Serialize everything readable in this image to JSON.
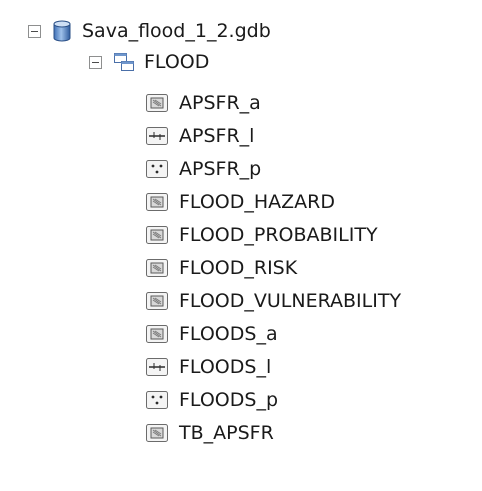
{
  "tree": {
    "database": {
      "label": "Sava_flood_1_2.gdb",
      "icon": "database-icon",
      "expanded": true
    },
    "dataset": {
      "label": "FLOOD",
      "icon": "feature-dataset-icon",
      "expanded": true
    },
    "feature_classes": [
      {
        "label": "APSFR_a",
        "icon": "polygon-feature-class-icon"
      },
      {
        "label": "APSFR_l",
        "icon": "line-feature-class-icon"
      },
      {
        "label": "APSFR_p",
        "icon": "point-feature-class-icon"
      },
      {
        "label": "FLOOD_HAZARD",
        "icon": "polygon-feature-class-icon"
      },
      {
        "label": "FLOOD_PROBABILITY",
        "icon": "polygon-feature-class-icon"
      },
      {
        "label": "FLOOD_RISK",
        "icon": "polygon-feature-class-icon"
      },
      {
        "label": "FLOOD_VULNERABILITY",
        "icon": "polygon-feature-class-icon"
      },
      {
        "label": "FLOODS_a",
        "icon": "polygon-feature-class-icon"
      },
      {
        "label": "FLOODS_l",
        "icon": "line-feature-class-icon"
      },
      {
        "label": "FLOODS_p",
        "icon": "point-feature-class-icon"
      },
      {
        "label": "TB_APSFR",
        "icon": "polygon-feature-class-icon"
      }
    ]
  }
}
